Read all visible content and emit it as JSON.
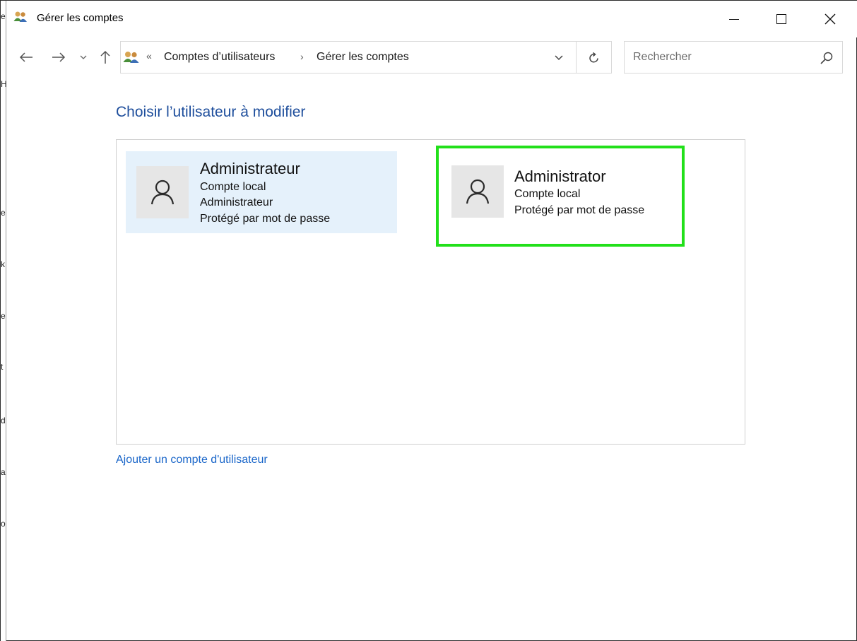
{
  "window": {
    "title": "Gérer les comptes",
    "icon": "user-accounts-icon"
  },
  "navigation": {
    "back_icon": "arrow-left-icon",
    "forward_icon": "arrow-right-icon",
    "recent_icon": "chevron-down-icon",
    "up_icon": "arrow-up-icon"
  },
  "address_bar": {
    "overflow": "«",
    "breadcrumbs": [
      "Comptes d’utilisateurs",
      "Gérer les comptes"
    ],
    "separator": "›"
  },
  "search": {
    "placeholder": "Rechercher"
  },
  "main": {
    "heading": "Choisir l’utilisateur à modifier",
    "accounts": [
      {
        "name": "Administrateur",
        "lines": [
          "Compte local",
          "Administrateur",
          "Protégé par mot de passe"
        ],
        "selected": true
      },
      {
        "name": "Administrator",
        "lines": [
          "Compte local",
          "Protégé par mot de passe"
        ],
        "highlighted": true
      }
    ],
    "add_account_link": "Ajouter un compte d'utilisateur"
  },
  "colors": {
    "heading": "#1e4e9c",
    "link": "#1a66c9",
    "selected_card": "#e5f1fb",
    "highlight_border": "#22e01a",
    "avatar_bg": "#e6e6e6"
  },
  "left_edge_letters": [
    "e",
    "H",
    "e",
    "k",
    "e",
    "t",
    "d",
    "a",
    "o"
  ]
}
